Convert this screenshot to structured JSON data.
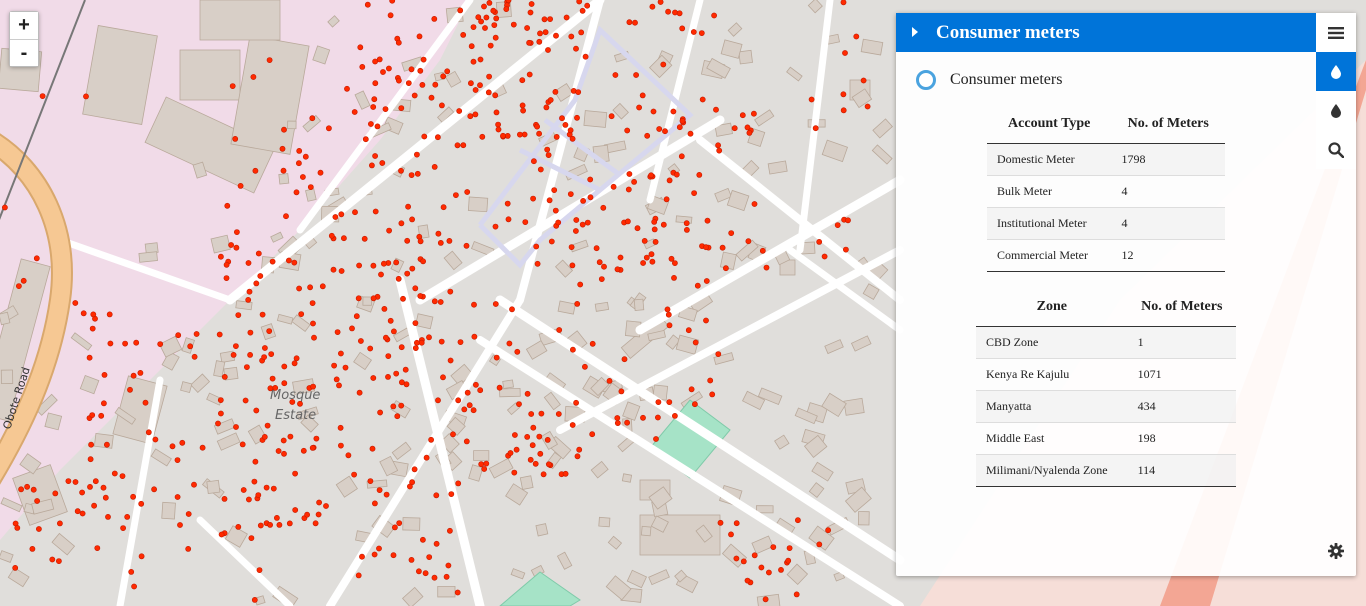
{
  "map": {
    "labels": {
      "road_obote": "Obote Road",
      "mosque_estate_1": "Mosque",
      "mosque_estate_2": "Estate"
    },
    "colors": {
      "background": "#e0dedb",
      "residential": "#f1dbe8",
      "road_major": "#f6c893",
      "road_major_edge": "#d9a86d",
      "road": "#ffffff",
      "building": "#d8cfc7",
      "building_edge": "#b9a99b",
      "park": "#a6e3c7",
      "meter_point": "#ff2a00",
      "meter_point_edge": "#c41a00",
      "waterline": "#d7d7ee"
    }
  },
  "zoom_control": {
    "zoom_in_label": "+",
    "zoom_out_label": "-"
  },
  "panel": {
    "title": "Consumer meters",
    "layer_label": "Consumer meters",
    "header_color": "#0074d9",
    "tabs": [
      {
        "icon": "menu-icon",
        "active": false
      },
      {
        "icon": "water-drop-icon",
        "active": true
      },
      {
        "icon": "water-drop-icon",
        "active": false
      },
      {
        "icon": "search-icon",
        "active": false
      }
    ],
    "footer_icon": "gear-icon",
    "account_table": {
      "headers": [
        "Account Type",
        "No. of Meters"
      ],
      "rows": [
        [
          "Domestic Meter",
          "1798"
        ],
        [
          "Bulk Meter",
          "4"
        ],
        [
          "Institutional Meter",
          "4"
        ],
        [
          "Commercial Meter",
          "12"
        ]
      ]
    },
    "zone_table": {
      "headers": [
        "Zone",
        "No. of Meters"
      ],
      "rows": [
        [
          "CBD Zone",
          "1"
        ],
        [
          "Kenya Re Kajulu",
          "1071"
        ],
        [
          "Manyatta",
          "434"
        ],
        [
          "Middle East",
          "198"
        ],
        [
          "Milimani/Nyalenda Zone",
          "114"
        ]
      ]
    }
  }
}
